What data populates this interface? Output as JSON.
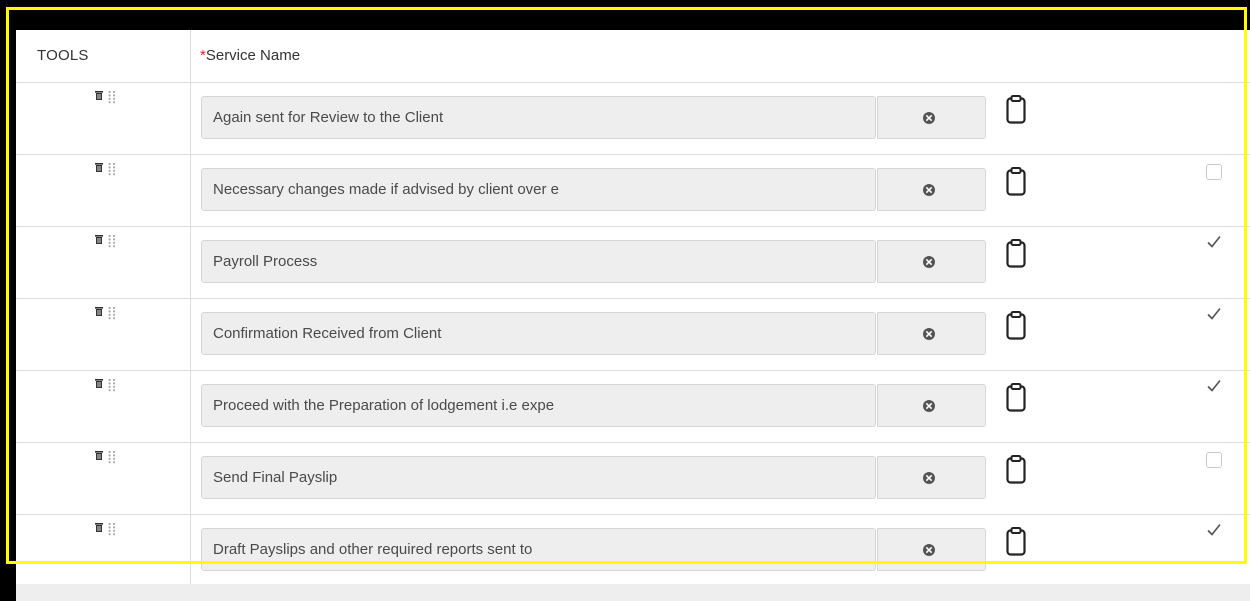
{
  "header": {
    "tools_label": "TOOLS",
    "required_mark": "*",
    "service_name_label": "Service Name"
  },
  "icons": {
    "delete": "trash-icon",
    "reorder": "drag-handle-icon",
    "clear": "clear-x-icon",
    "copy": "clipboard-icon",
    "toggle": "checkbox-icon"
  },
  "colors": {
    "required": "#d9262c",
    "highlight": "#ffff00",
    "field_bg": "#eeeeee"
  },
  "rows": [
    {
      "name": "Again sent for Review to the Client",
      "checkbox": "none"
    },
    {
      "name": "Necessary changes made if advised by client over e",
      "checkbox": "unchecked"
    },
    {
      "name": "Payroll Process",
      "checkbox": "checked"
    },
    {
      "name": "Confirmation Received from Client",
      "checkbox": "checked"
    },
    {
      "name": "Proceed with the Preparation of lodgement i.e expe",
      "checkbox": "checked"
    },
    {
      "name": "Send Final Payslip",
      "checkbox": "unchecked"
    },
    {
      "name": "Draft Payslips and other required reports sent to",
      "checkbox": "checked"
    }
  ]
}
